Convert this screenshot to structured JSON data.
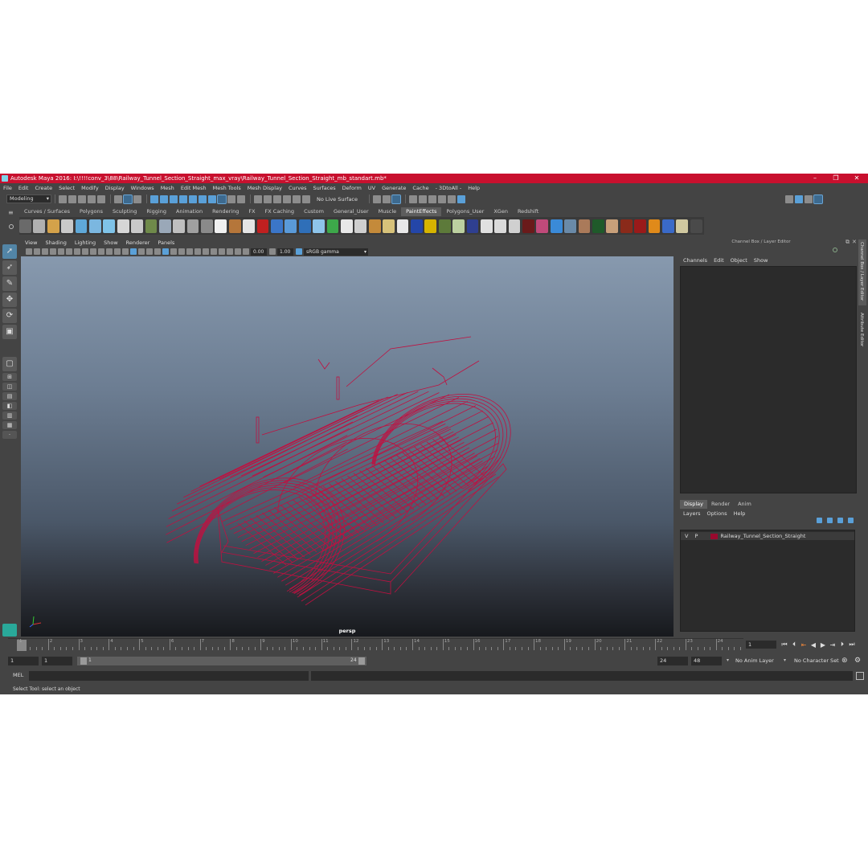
{
  "window": {
    "title": "Autodesk Maya 2016: I:\\!!!!conv_3\\88\\Railway_Tunnel_Section_Straight_max_vray\\Railway_Tunnel_Section_Straight_mb_standart.mb*",
    "minimize": "–",
    "maximize": "❐",
    "close": "✕"
  },
  "menubar": [
    "File",
    "Edit",
    "Create",
    "Select",
    "Modify",
    "Display",
    "Windows",
    "Mesh",
    "Edit Mesh",
    "Mesh Tools",
    "Mesh Display",
    "Curves",
    "Surfaces",
    "Deform",
    "UV",
    "Generate",
    "Cache",
    "- 3DtoAll -",
    "Help"
  ],
  "statusline": {
    "mode": "Modeling",
    "live_surface": "No Live Surface"
  },
  "shelf": {
    "tabs": [
      "Curves / Surfaces",
      "Polygons",
      "Sculpting",
      "Rigging",
      "Animation",
      "Rendering",
      "FX",
      "FX Caching",
      "Custom",
      "General_User",
      "Muscle",
      "PaintEffects",
      "Polygons_User",
      "XGen",
      "Redshift"
    ],
    "active_tab": "PaintEffects",
    "icon_colors": [
      "#6a6a6a",
      "#b0b0b0",
      "#d4a24a",
      "#c9c9c9",
      "#5fa8d8",
      "#7bb7e0",
      "#7fc3e8",
      "#d6d6d6",
      "#c9c9c9",
      "#6f8a4a",
      "#9aa8b8",
      "#bfbfbf",
      "#a0a0a0",
      "#8a8a8a",
      "#f0f0f0",
      "#b5763a",
      "#e5e5e5",
      "#c02020",
      "#3b76c8",
      "#5a9ad8",
      "#2f6fb8",
      "#8ec4ea",
      "#3da84a",
      "#e8e8e8",
      "#cfcfcf",
      "#c48a3a",
      "#d7c27a",
      "#e8e8e8",
      "#2446a8",
      "#d6b400",
      "#5d7a3a",
      "#bcd0a0",
      "#2f3f90",
      "#e0e0e0",
      "#dadada",
      "#d0d0d0",
      "#6a1a1a",
      "#c04a7a",
      "#3a8ad8",
      "#6a8aa8",
      "#aa7a5a",
      "#1f5a2a",
      "#c8a07a",
      "#8a2a1a",
      "#9a1a1a",
      "#e08a1a",
      "#3a6ac8",
      "#d0c8a0",
      "#4a4a4a"
    ]
  },
  "viewport": {
    "menu": [
      "View",
      "Shading",
      "Lighting",
      "Show",
      "Renderer",
      "Panels"
    ],
    "exposure": "0.00",
    "gamma": "1.00",
    "color_space": "sRGB gamma",
    "camera": "persp"
  },
  "channel_box": {
    "title": "Channel Box / Layer Editor",
    "menu": [
      "Channels",
      "Edit",
      "Object",
      "Show"
    ],
    "side_tab_1": "Channel Box / Layer Editor",
    "side_tab_2": "Attribute Editor"
  },
  "layer_editor": {
    "tabs": [
      "Display",
      "Render",
      "Anim"
    ],
    "active_tab": "Display",
    "menu": [
      "Layers",
      "Options",
      "Help"
    ],
    "layer": {
      "visible": "V",
      "playback": "P",
      "name": "Railway_Tunnel_Section_Straight",
      "color": "#990a2e"
    }
  },
  "timeline": {
    "ticks": [
      "1",
      "2",
      "3",
      "4",
      "5",
      "6",
      "7",
      "8",
      "9",
      "10",
      "11",
      "12",
      "13",
      "14",
      "15",
      "16",
      "17",
      "18",
      "19",
      "20",
      "21",
      "22",
      "23",
      "24"
    ],
    "current_frame": "1"
  },
  "range": {
    "start": "1",
    "anim_start": "1",
    "slider_start": "1",
    "slider_end": "24",
    "end": "24",
    "anim_end": "48",
    "anim_layer": "No Anim Layer",
    "character_set": "No Character Set"
  },
  "command_line": {
    "language": "MEL"
  },
  "help_line": "Select Tool: select an object",
  "wireframe_color": "#c01040"
}
